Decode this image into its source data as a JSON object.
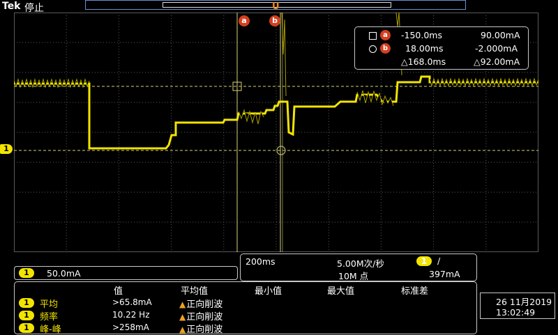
{
  "header": {
    "brand": "Tek",
    "status": "停止",
    "trigger_marker": "U"
  },
  "cursors": {
    "a": {
      "label": "a",
      "time": "-150.0ms",
      "value": "90.00mA"
    },
    "b": {
      "label": "b",
      "time": "18.00ms",
      "value": "-2.000mA"
    },
    "delta_time": "△168.0ms",
    "delta_value": "△92.00mA"
  },
  "channel": {
    "number": "1",
    "color": "#f2e400",
    "scale": "50.0mA"
  },
  "horizontal": {
    "timebase": "200ms",
    "sample_rate": "5.00M次/秒",
    "record_length": "10M 点",
    "trigger_channel": "1",
    "trigger_slope": "/",
    "trigger_level": "397mA"
  },
  "measurements": {
    "headers": [
      "值",
      "平均值",
      "最小值",
      "最大值",
      "标准差"
    ],
    "rows": [
      {
        "channel": "1",
        "name": "平均",
        "value": ">65.8mA",
        "warning": "正向削波"
      },
      {
        "channel": "1",
        "name": "频率",
        "value": "10.22 Hz",
        "warning": "正向削波"
      },
      {
        "channel": "1",
        "name": "峰-峰",
        "value": ">258mA",
        "warning": "正向削波"
      }
    ]
  },
  "clock": {
    "date": "26 11月2019",
    "time": "13:02:49"
  },
  "colors": {
    "trace": "#f2e400",
    "cursor_badge": "#d33f1f",
    "grid": "#5a5a5a",
    "border": "#c9c9c9",
    "overview": "#6b8fd6"
  }
}
